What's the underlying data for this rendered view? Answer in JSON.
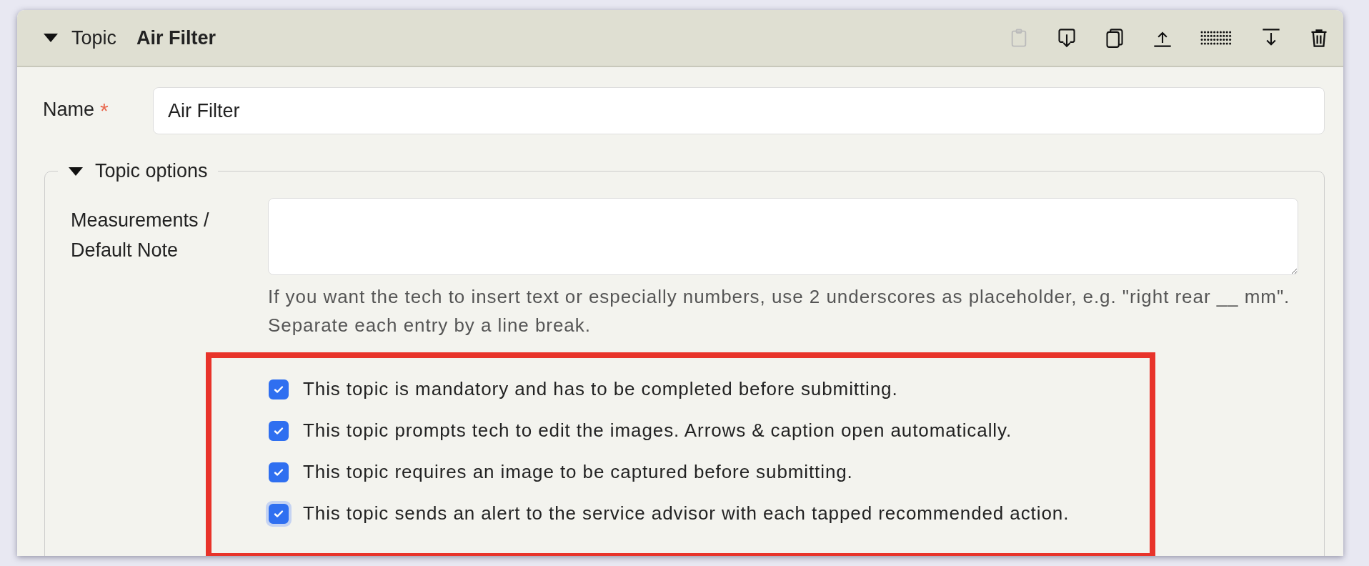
{
  "header": {
    "expanded": true,
    "label": "Topic",
    "title": "Air Filter",
    "toolbar": [
      {
        "kind": "paste",
        "disabled": true
      },
      {
        "kind": "import",
        "disabled": false
      },
      {
        "kind": "copy",
        "disabled": false
      },
      {
        "kind": "move-top",
        "disabled": false
      },
      {
        "kind": "drag",
        "disabled": false
      },
      {
        "kind": "move-bottom",
        "disabled": false
      },
      {
        "kind": "delete",
        "disabled": false
      }
    ]
  },
  "name_field": {
    "label": "Name",
    "required": true,
    "required_mark": "*",
    "value": "Air Filter"
  },
  "topic_options": {
    "expanded": true,
    "legend": "Topic options",
    "note_field": {
      "label": "Measurements / Default Note",
      "help": "If you want the tech to insert text or especially numbers, use 2 underscores as placeholder, e.g. \"right rear __ mm\". Separate each entry by a line break."
    },
    "options": [
      {
        "label": "This topic is mandatory and has to be completed before submitting.",
        "checked": true,
        "focused": false
      },
      {
        "label": "This topic prompts tech to edit the images. Arrows & caption open automatically.",
        "checked": true,
        "focused": false
      },
      {
        "label": "This topic requires an image to be captured before submitting.",
        "checked": true,
        "focused": false
      },
      {
        "label": "This topic sends an alert to the service advisor with each tapped recommended action.",
        "checked": true,
        "focused": true
      }
    ]
  }
}
